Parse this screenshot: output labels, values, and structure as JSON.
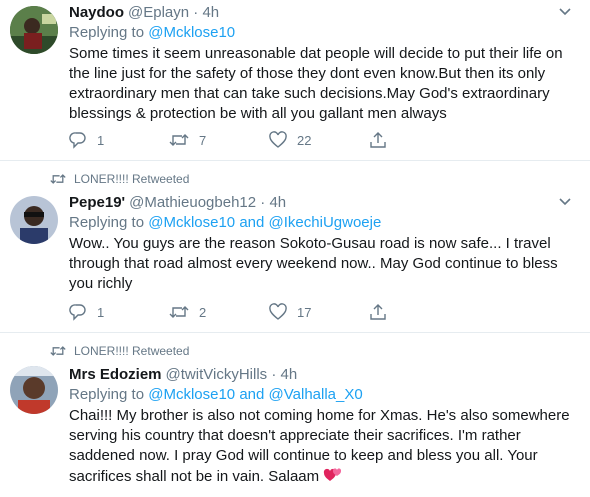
{
  "tweets": [
    {
      "retweet_context": "",
      "name": "Naydoo",
      "handle": "@Eplayn",
      "sep": "·",
      "time": "4h",
      "replying_prefix": "Replying to ",
      "mention1": "@Mcklose10",
      "and": "",
      "mention2": "",
      "text": "Some times it seem unreasonable dat people will decide to put their life on the line just for the safety of those they dont even know.But then its only extraordinary men that can take such decisions.May God's extraordinary blessings & protection be with all you gallant men always",
      "replies": "1",
      "retweets": "7",
      "likes": "22",
      "avatar_icon": "avatar-photo-icon"
    },
    {
      "retweet_context": "LONER!!!! Retweeted",
      "name": "Pepe19'",
      "handle": "@Mathieuogbeh12",
      "sep": "·",
      "time": "4h",
      "replying_prefix": "Replying to ",
      "mention1": "@Mcklose10",
      "and": " and ",
      "mention2": "@IkechiUgwoeje",
      "text": "Wow.. You guys are the reason Sokoto-Gusau road is now safe... I travel through that road almost every weekend now.. May God continue to bless you richly",
      "replies": "1",
      "retweets": "2",
      "likes": "17",
      "avatar_icon": "avatar-photo-icon"
    },
    {
      "retweet_context": "LONER!!!! Retweeted",
      "name": "Mrs Edoziem",
      "handle": "@twitVickyHills",
      "sep": "·",
      "time": "4h",
      "replying_prefix": "Replying to ",
      "mention1": "@Mcklose10",
      "and": " and ",
      "mention2": "@Valhalla_X0",
      "text": "Chai!!! My brother is also not coming home for Xmas. He's also somewhere serving his country that doesn't appreciate their sacrifices. I'm rather saddened now. I pray God will continue to keep and bless you all. Your sacrifices shall not be in vain. Salaam",
      "emoji": "two-hearts-icon",
      "avatar_icon": "avatar-photo-icon"
    }
  ],
  "colors": {
    "link": "#1da1f2",
    "secondary": "#657786",
    "text": "#14171a",
    "divider": "#e6ecf0",
    "heart": "#e0245e"
  }
}
